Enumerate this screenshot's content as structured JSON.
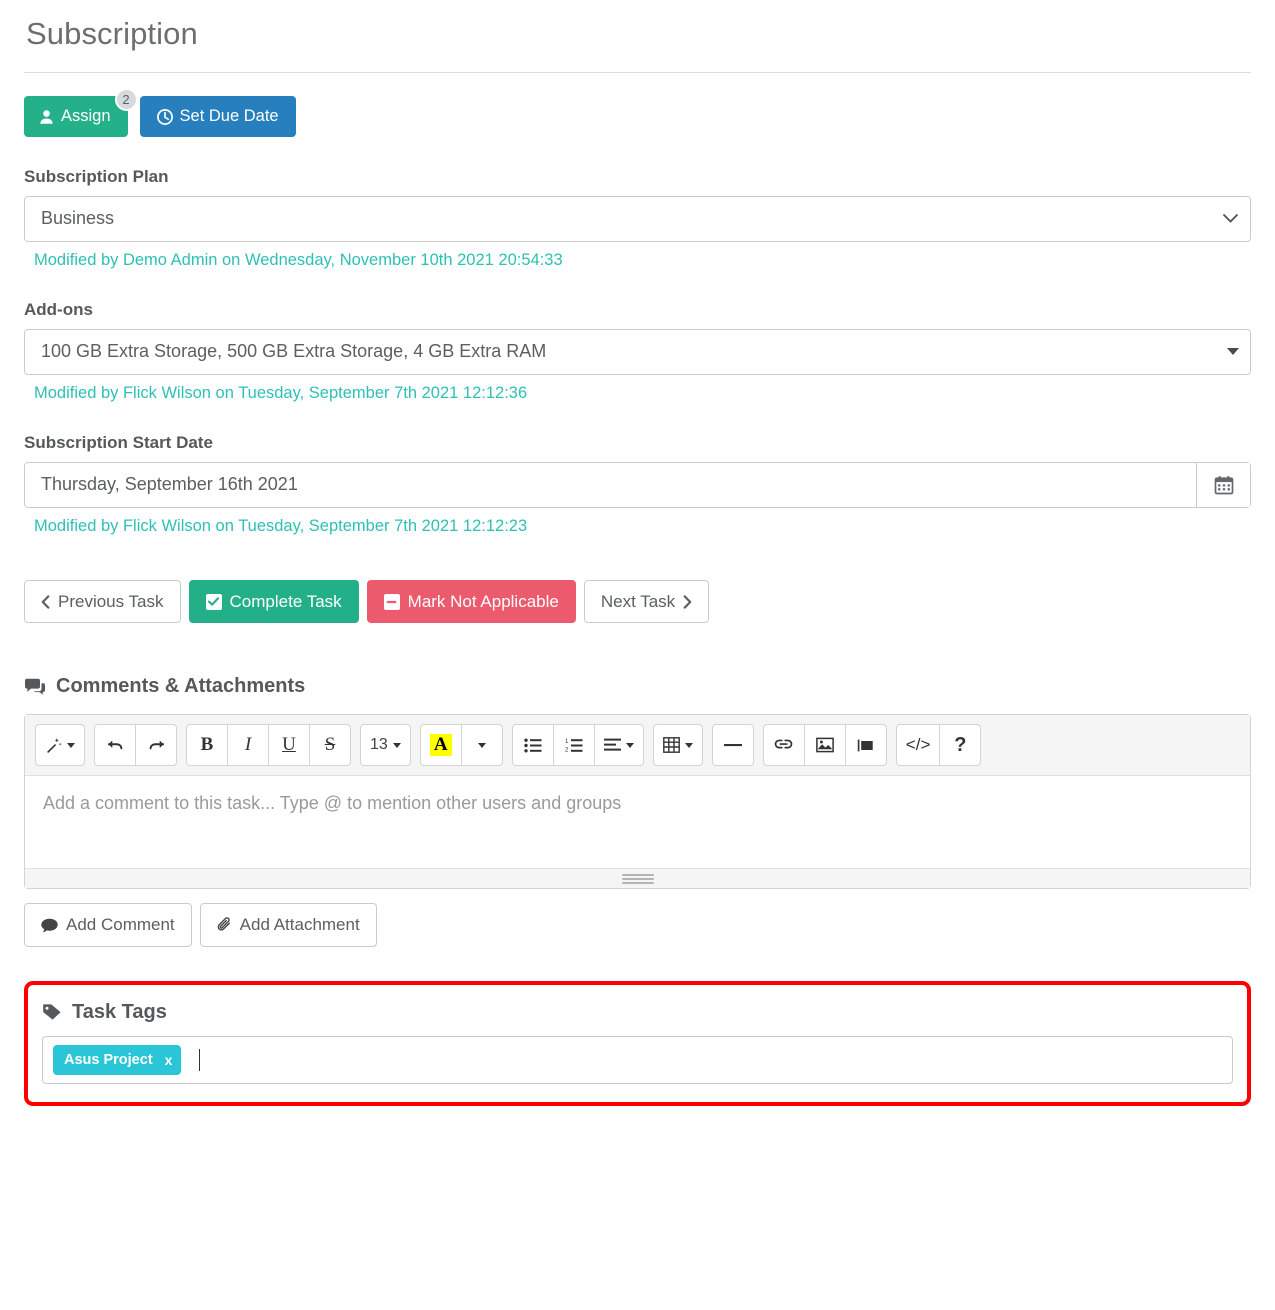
{
  "header": {
    "title": "Subscription"
  },
  "actions": {
    "assign": {
      "label": "Assign",
      "badge": "2",
      "icon": "user-icon",
      "color": "#24b089"
    },
    "set_due_date": {
      "label": "Set Due Date",
      "icon": "clock-icon",
      "color": "#2780bd"
    }
  },
  "fields": [
    {
      "label": "Subscription Plan",
      "value": "Business",
      "control": "select",
      "modified": "Modified by Demo Admin on Wednesday, November 10th 2021 20:54:33"
    },
    {
      "label": "Add-ons",
      "value": "100 GB Extra Storage, 500 GB Extra Storage, 4 GB Extra RAM",
      "control": "multiselect",
      "modified": "Modified by Flick Wilson on Tuesday, September 7th 2021 12:12:36"
    },
    {
      "label": "Subscription Start Date",
      "value": "Thursday, September 16th 2021",
      "control": "date",
      "modified": "Modified by Flick Wilson on Tuesday, September 7th 2021 12:12:23"
    }
  ],
  "task_nav": {
    "previous": "Previous Task",
    "complete": "Complete Task",
    "not_applicable": "Mark Not Applicable",
    "next": "Next Task"
  },
  "comments": {
    "heading": "Comments & Attachments",
    "placeholder": "Add a comment to this task... Type @ to mention other users and groups",
    "font_size": "13",
    "add_comment": "Add Comment",
    "add_attachment": "Add Attachment",
    "toolbar_icons": [
      "magic-wand-icon",
      "undo-icon",
      "redo-icon",
      "bold-icon",
      "italic-icon",
      "underline-icon",
      "strikethrough-icon",
      "font-size-icon",
      "text-color-icon",
      "unordered-list-icon",
      "ordered-list-icon",
      "paragraph-align-icon",
      "table-icon",
      "horizontal-rule-icon",
      "link-icon",
      "image-icon",
      "video-icon",
      "code-view-icon",
      "help-icon"
    ]
  },
  "task_tags": {
    "heading": "Task Tags",
    "icon": "tag-icon",
    "tags": [
      {
        "label": "Asus Project",
        "remove": "x",
        "color": "#2ac6d8"
      }
    ],
    "highlight_color": "#ff0000"
  },
  "colors": {
    "teal": "#24b089",
    "blue": "#2780bd",
    "red": "#ec5a6d",
    "modified_text": "#2fc0b4",
    "chip": "#2ac6d8"
  }
}
